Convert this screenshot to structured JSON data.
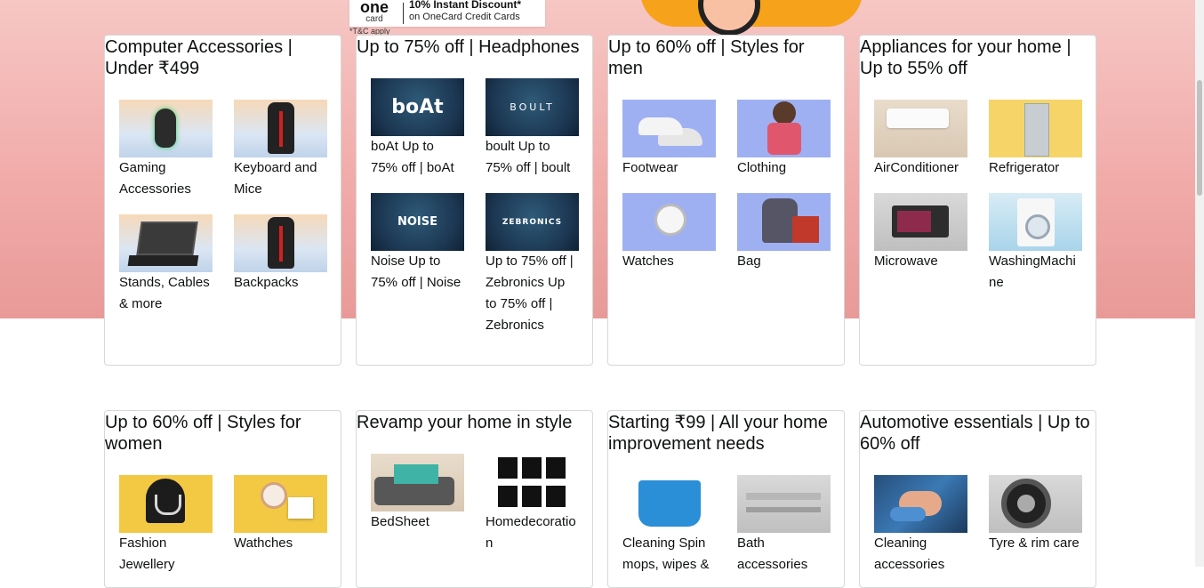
{
  "promo": {
    "logo_big": "one",
    "logo_small": "card",
    "line1": "10% Instant Discount*",
    "line2": "on OneCard Credit Cards",
    "tnc": "*T&C apply"
  },
  "cards_row1": [
    {
      "title": "Computer Accessories | Under ₹499",
      "items": [
        {
          "label": "Gaming Accessories",
          "icon": "gaming-mouse"
        },
        {
          "label": "Keyboard and Mice",
          "icon": "backpack"
        },
        {
          "label": "Stands, Cables & more",
          "icon": "laptop-stand"
        },
        {
          "label": "Backpacks",
          "icon": "backpack"
        }
      ]
    },
    {
      "title": "Up to 75% off | Headphones",
      "items": [
        {
          "label": "boAt Up to 75% off | boAt",
          "brand": "boAt"
        },
        {
          "label": "boult Up to 75% off | boult",
          "brand": "BOULT"
        },
        {
          "label": "Noise Up to 75% off | Noise",
          "brand": "NOISE"
        },
        {
          "label": "Up to 75% off | Zebronics Up to 75% off | Zebronics",
          "brand": "ZEBRONICS"
        }
      ]
    },
    {
      "title": "Up to 60% off | Styles for men",
      "items": [
        {
          "label": "Footwear",
          "icon": "sneakers"
        },
        {
          "label": "Clothing",
          "icon": "man"
        },
        {
          "label": "Watches",
          "icon": "watch"
        },
        {
          "label": "Bag",
          "icon": "luggage"
        }
      ]
    },
    {
      "title": "Appliances for your home | Up to 55% off",
      "items": [
        {
          "label": "AirConditioner",
          "icon": "ac"
        },
        {
          "label": "Refrigerator",
          "icon": "fridge"
        },
        {
          "label": "Microwave",
          "icon": "microwave"
        },
        {
          "label": "WashingMachine",
          "icon": "washer"
        }
      ]
    }
  ],
  "cards_row2": [
    {
      "title": "Up to 60% off | Styles for women",
      "items": [
        {
          "label": "Fashion Jewellery",
          "icon": "necklace"
        },
        {
          "label": "Wathches",
          "icon": "watch"
        }
      ]
    },
    {
      "title": "Revamp your home in style",
      "items": [
        {
          "label": "BedSheet",
          "icon": "sofa"
        },
        {
          "label": "Homedecoration",
          "icon": "frames"
        }
      ]
    },
    {
      "title": "Starting ₹99 | All your home improvement needs",
      "items": [
        {
          "label": "Cleaning Spin mops, wipes &",
          "icon": "bucket"
        },
        {
          "label": "Bath accessories",
          "icon": "shelf"
        }
      ]
    },
    {
      "title": "Automotive essentials | Up to 60% off",
      "items": [
        {
          "label": "Cleaning accessories",
          "icon": "car-cleaning"
        },
        {
          "label": "Tyre & rim care",
          "icon": "tyre"
        }
      ]
    }
  ],
  "colors": {
    "hero_top": "#f6c7c4",
    "hero_bottom": "#e89a98",
    "card_border": "#d5d9d9",
    "text": "#0f1111"
  }
}
